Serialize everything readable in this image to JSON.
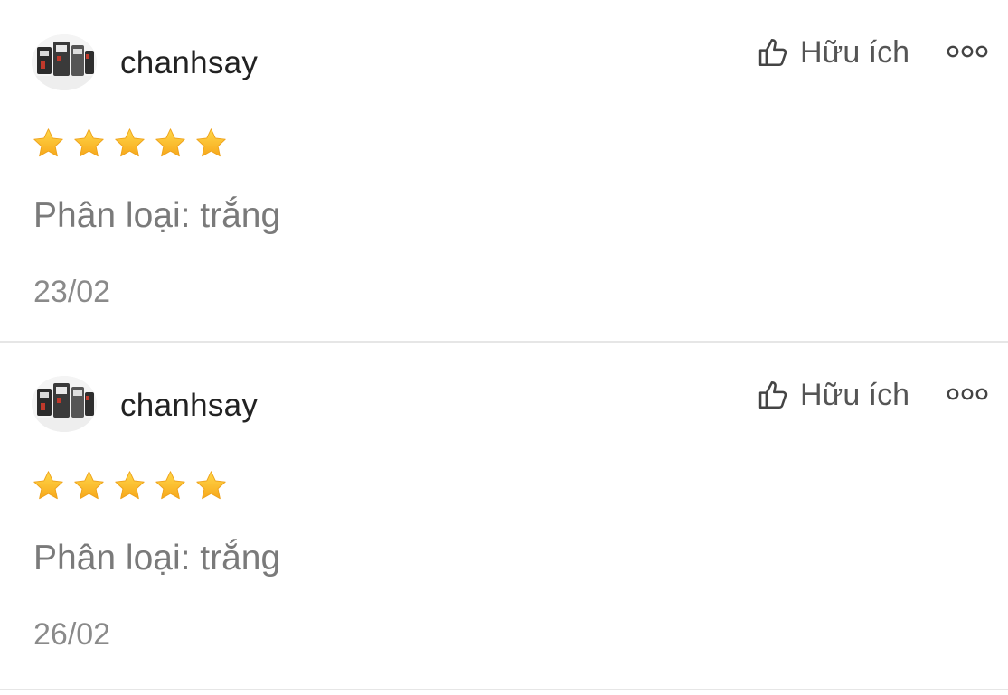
{
  "reviews": [
    {
      "username": "chanhsay",
      "rating": 5,
      "helpful_label": "Hữu ích",
      "variant": "Phân loại: trắng",
      "date": "23/02"
    },
    {
      "username": "chanhsay",
      "rating": 5,
      "helpful_label": "Hữu ích",
      "variant": "Phân loại: trắng",
      "date": "26/02"
    }
  ],
  "icons": {
    "helpful": "thumbs-up-icon",
    "more": "more-options-icon",
    "star": "star-icon"
  },
  "colors": {
    "star": "#ffc52a",
    "divider": "#e6e6e6",
    "secondary_text": "#7a7a7a"
  }
}
